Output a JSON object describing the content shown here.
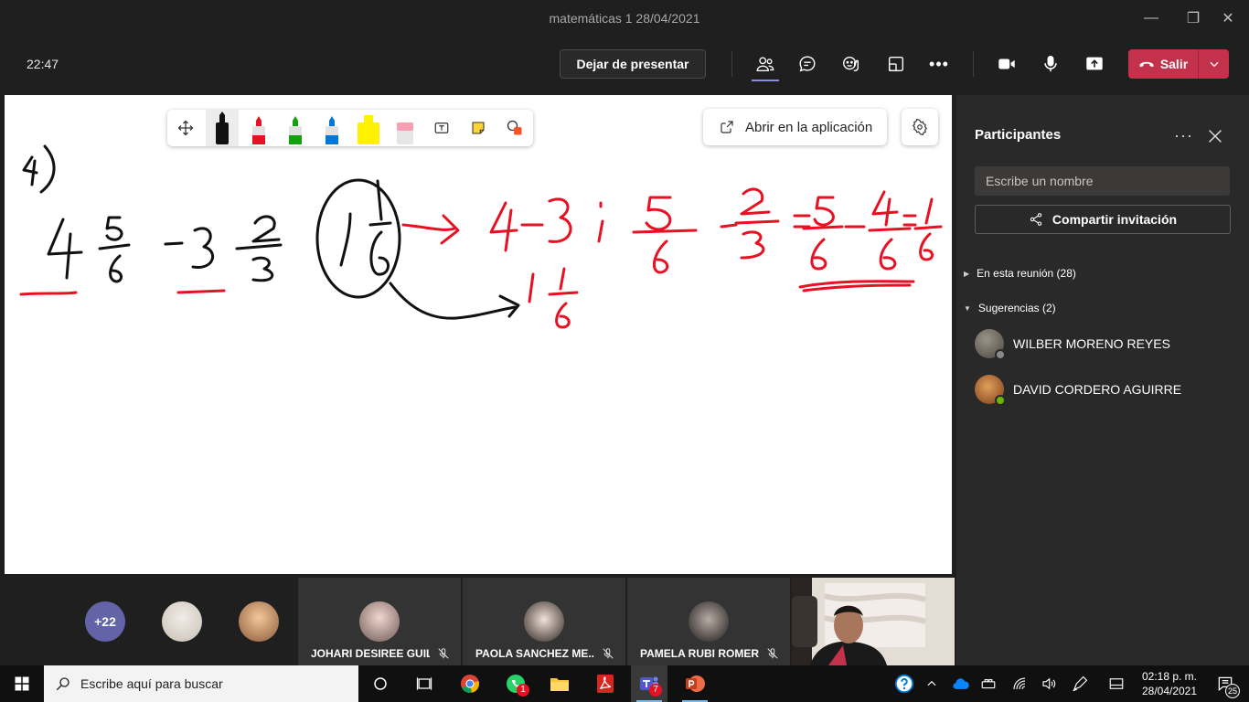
{
  "window": {
    "title": "matemáticas 1 28/04/2021",
    "minimize": "—",
    "restore": "❐",
    "close": "✕"
  },
  "meeting": {
    "clock": "22:47",
    "stop_presenting": "Dejar de presentar",
    "leave": "Salir"
  },
  "whiteboard": {
    "open_in_app": "Abrir en la aplicación",
    "tools": [
      "move",
      "black-pen",
      "red-pen",
      "green-pen",
      "blue-pen",
      "highlighter",
      "eraser",
      "text",
      "sticky-note",
      "shapes"
    ],
    "ink_colors": {
      "black": "#111111",
      "red": "#e81123"
    }
  },
  "panel": {
    "title": "Participantes",
    "more": "···",
    "search_placeholder": "Escribe un nombre",
    "invite": "Compartir invitación",
    "in_meeting": "En esta reunión (28)",
    "suggestions": "Sugerencias (2)",
    "people": [
      {
        "name": "WILBER MORENO REYES"
      },
      {
        "name": "DAVID CORDERO AGUIRRE"
      }
    ]
  },
  "strip": {
    "overflow": "+22",
    "tiles": [
      {
        "name": "JOHARI DESIREE GUIL..."
      },
      {
        "name": "PAOLA SANCHEZ ME..."
      },
      {
        "name": "PAMELA RUBI ROMER..."
      }
    ]
  },
  "taskbar": {
    "search_placeholder": "Escribe aquí para buscar",
    "whatsapp_badge": "1",
    "teams_badge": "7",
    "time": "02:18 p. m.",
    "date": "28/04/2021",
    "notifications": "25"
  },
  "colors": {
    "leave": "#c4314b",
    "accent": "#8b8ce6",
    "panel": "#292929"
  }
}
